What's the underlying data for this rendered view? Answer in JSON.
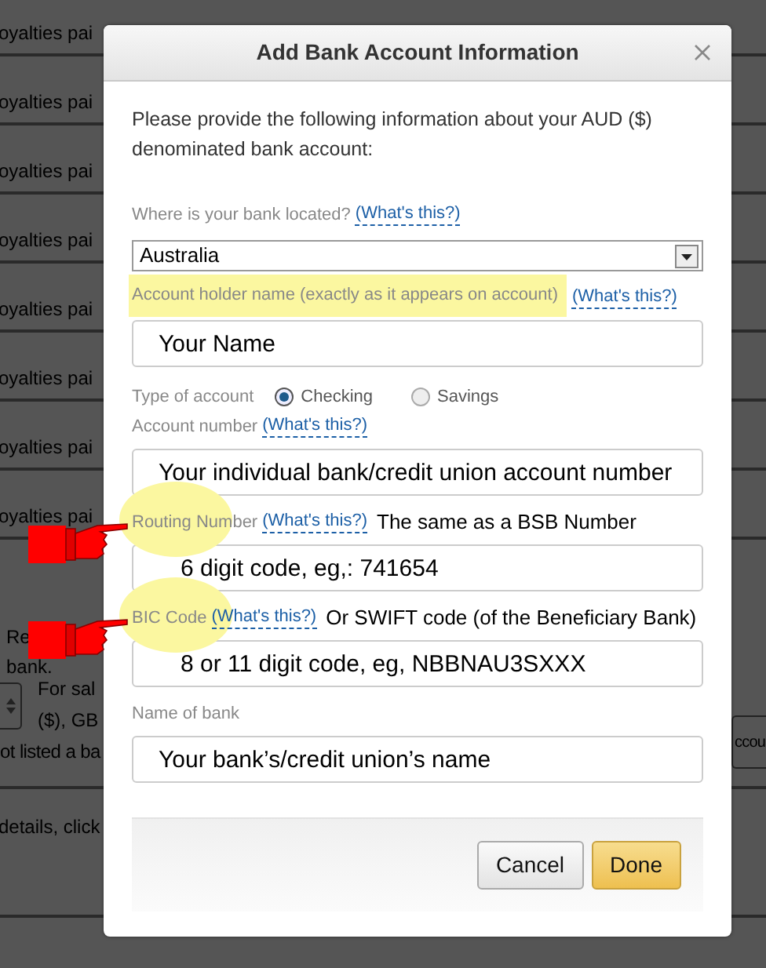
{
  "background": {
    "rows": [
      {
        "text": "oyalties pai"
      },
      {
        "text": "oyalties pai"
      },
      {
        "text": "oyalties pai"
      },
      {
        "text": "oyalties pai"
      },
      {
        "text": "oyalties pai"
      },
      {
        "text": "oyalties pai"
      },
      {
        "text": "oyalties pai"
      },
      {
        "text": "oyalties pai"
      }
    ],
    "notice": [
      "Re",
      "bank."
    ],
    "sales": [
      "For sal",
      "($), GB"
    ],
    "unlisted": "ot listed a ba",
    "side_button": "ccou",
    "details": "details, click"
  },
  "dialog": {
    "title": "Add Bank Account Information",
    "intro": "Please provide the following information about your AUD ($) denominated bank account:",
    "fields": [
      {
        "kind": "select",
        "label": "Where is your bank located?",
        "help": "(What's this?)",
        "value": "Australia"
      },
      {
        "kind": "text",
        "label": "Account holder name (exactly as it appears on account)",
        "help": "(What's this?)",
        "value": "Your Name",
        "highlighted": true
      },
      {
        "kind": "radio",
        "label": "Type of account",
        "options": [
          {
            "label": "Checking",
            "selected": true
          },
          {
            "label": "Savings",
            "selected": false
          }
        ]
      },
      {
        "kind": "text",
        "label": "Account number",
        "help": "(What's this?)",
        "value": "Your individual bank/credit union account number"
      },
      {
        "kind": "text",
        "label": "Routing Number",
        "help": "(What's this?)",
        "note": "The same as a BSB Number",
        "value": "6 digit code, eg,: 741654",
        "highlighted": true,
        "pointer": true
      },
      {
        "kind": "text",
        "label": "BIC Code",
        "help": "(What's this?)",
        "note": "Or SWIFT code (of the Beneficiary Bank)",
        "value": "8 or 11 digit code, eg, NBBNAU3SXXX",
        "highlighted": true,
        "pointer": true
      },
      {
        "kind": "text",
        "label": "Name of bank",
        "value": "Your bank’s/credit union’s name"
      }
    ],
    "buttons": [
      {
        "label": "Cancel",
        "kind": "secondary"
      },
      {
        "label": "Done",
        "kind": "primary"
      }
    ]
  }
}
